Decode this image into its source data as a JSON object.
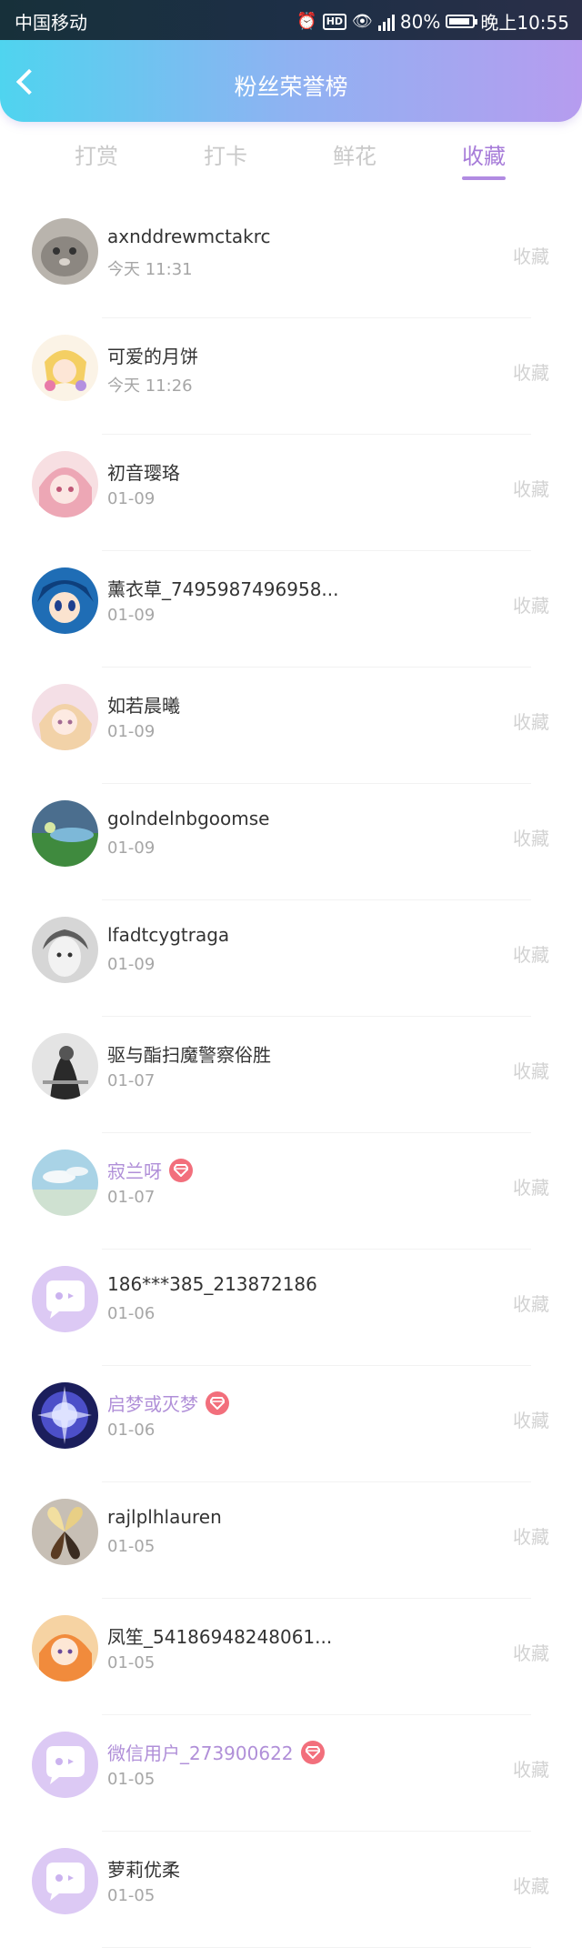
{
  "status_bar": {
    "carrier": "中国移动",
    "battery": "80%",
    "time": "晚上10:55"
  },
  "header": {
    "title": "粉丝荣誉榜"
  },
  "tabs": [
    {
      "label": "打赏"
    },
    {
      "label": "打卡"
    },
    {
      "label": "鲜花"
    },
    {
      "label": "收藏"
    }
  ],
  "active_tab": "收藏",
  "colors": {
    "accent": "#a77cd9",
    "vip_badge": "#f26f7c",
    "header_start": "#4fd4ef",
    "header_end": "#b69cef"
  },
  "fans": [
    {
      "name": "axnddrewmctakrc",
      "time": "今天 11:31",
      "action": "收藏",
      "vip": false,
      "avatar": "cat-photo"
    },
    {
      "name": "可爱的月饼",
      "time": "今天 11:26",
      "action": "收藏",
      "vip": false,
      "avatar": "anime-girl-yellow"
    },
    {
      "name": "初音璎珞",
      "time": "01-09",
      "action": "收藏",
      "vip": false,
      "avatar": "anime-girl-pink"
    },
    {
      "name": "薰衣草_7495987496958...",
      "time": "01-09",
      "action": "收藏",
      "vip": false,
      "avatar": "anime-boy-blue"
    },
    {
      "name": "如若晨曦",
      "time": "01-09",
      "action": "收藏",
      "vip": false,
      "avatar": "anime-girl-pastel"
    },
    {
      "name": "golndelnbgoomse",
      "time": "01-09",
      "action": "收藏",
      "vip": false,
      "avatar": "landscape"
    },
    {
      "name": "lfadtcygtraga",
      "time": "01-09",
      "action": "收藏",
      "vip": false,
      "avatar": "child-bw-photo"
    },
    {
      "name": "驱与酯扫魔警察俗胜",
      "time": "01-07",
      "action": "收藏",
      "vip": false,
      "avatar": "woman-bw-photo"
    },
    {
      "name": "寂兰呀",
      "time": "01-07",
      "action": "收藏",
      "vip": true,
      "avatar": "sky-photo"
    },
    {
      "name": "186***385_213872186",
      "time": "01-06",
      "action": "收藏",
      "vip": false,
      "avatar": "default-chat"
    },
    {
      "name": "启梦或灭梦",
      "time": "01-06",
      "action": "收藏",
      "vip": true,
      "avatar": "anime-fighter"
    },
    {
      "name": "rajlplhlauren",
      "time": "01-05",
      "action": "收藏",
      "vip": false,
      "avatar": "flower-photo"
    },
    {
      "name": "凤笙_54186948248061...",
      "time": "01-05",
      "action": "收藏",
      "vip": false,
      "avatar": "anime-girl-orange"
    },
    {
      "name": "微信用户_273900622",
      "time": "01-05",
      "action": "收藏",
      "vip": true,
      "avatar": "default-chat"
    },
    {
      "name": "萝莉优柔",
      "time": "01-05",
      "action": "收藏",
      "vip": false,
      "avatar": "default-chat"
    }
  ]
}
